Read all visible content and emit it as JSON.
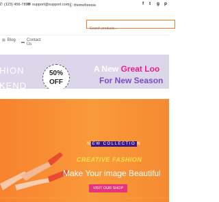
{
  "topbar": {
    "phone": "(123) 456-7890",
    "email": "support@support.com",
    "brand": "themefreesia",
    "social": [
      "f",
      "t",
      "g",
      "p"
    ]
  },
  "search": {
    "placeholder": "Search products..."
  },
  "nav": {
    "items": [
      {
        "label": "Blog"
      },
      {
        "label": "Contact Us"
      }
    ]
  },
  "promo": {
    "left_line1": "HION",
    "left_line2": "KEND",
    "discount": "50%",
    "off": "OFF",
    "line1_prefix": "A New ",
    "line1_highlight": "Great Loo",
    "line2": "For New Season"
  },
  "hero": {
    "new_prefix": "N",
    "new_box": "EW COLLECTIO",
    "new_suffix": "N",
    "creative": "CREATIVE FASHION",
    "headline": "Make Your image Beautiful",
    "button": "VISIT OUR SHOP"
  },
  "colors": {
    "accent": "#f27a2d",
    "pink": "#e91e8c",
    "purple": "#7a4cc0",
    "banner_bg": "#dcd6ea"
  }
}
